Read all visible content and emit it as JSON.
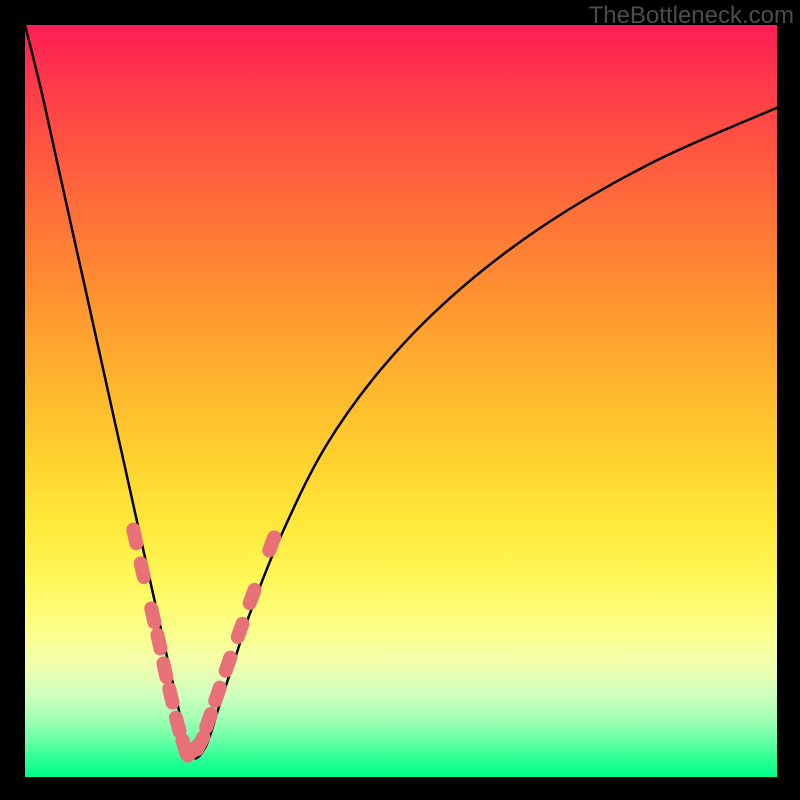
{
  "watermark": "TheBottleneck.com",
  "colors": {
    "frame_bg": "#000000",
    "curve_stroke": "#000000",
    "bead": "#e87177",
    "gradient_top": "#ff1d55",
    "gradient_bottom": "#00ff88"
  },
  "chart_data": {
    "type": "line",
    "title": "",
    "xlabel": "",
    "ylabel": "",
    "xlim": [
      0,
      100
    ],
    "ylim": [
      0,
      100
    ],
    "grid": false,
    "note": "V-shaped bottleneck curve with minimum near x≈22. Left branch descends steeply from top-left; right branch rises toward upper-right with diminishing slope. Pink sausage-shaped beads cluster along both branches near the valley floor.",
    "series": [
      {
        "name": "bottleneck-curve",
        "x": [
          0,
          2,
          4,
          6,
          8,
          10,
          12,
          14,
          16,
          18,
          20,
          22,
          24,
          26,
          28,
          30,
          34,
          40,
          48,
          58,
          70,
          84,
          100
        ],
        "values": [
          100,
          92,
          83,
          74,
          65,
          56,
          47,
          38,
          29,
          20,
          11,
          3,
          4,
          10,
          16,
          22,
          32,
          44,
          55,
          65,
          74,
          82,
          89
        ]
      }
    ],
    "beads_left": [
      {
        "x": 14.6,
        "y": 32.0
      },
      {
        "x": 15.6,
        "y": 27.5
      },
      {
        "x": 17.0,
        "y": 21.5
      },
      {
        "x": 17.8,
        "y": 18.0
      },
      {
        "x": 18.6,
        "y": 14.2
      },
      {
        "x": 19.4,
        "y": 10.8
      },
      {
        "x": 20.3,
        "y": 7.0
      },
      {
        "x": 21.2,
        "y": 4.0
      }
    ],
    "beads_right": [
      {
        "x": 22.3,
        "y": 3.5
      },
      {
        "x": 23.3,
        "y": 4.5
      },
      {
        "x": 24.4,
        "y": 7.5
      },
      {
        "x": 25.6,
        "y": 11.0
      },
      {
        "x": 27.0,
        "y": 15.0
      },
      {
        "x": 28.6,
        "y": 19.5
      },
      {
        "x": 30.2,
        "y": 24.0
      },
      {
        "x": 32.8,
        "y": 31.0
      }
    ]
  }
}
